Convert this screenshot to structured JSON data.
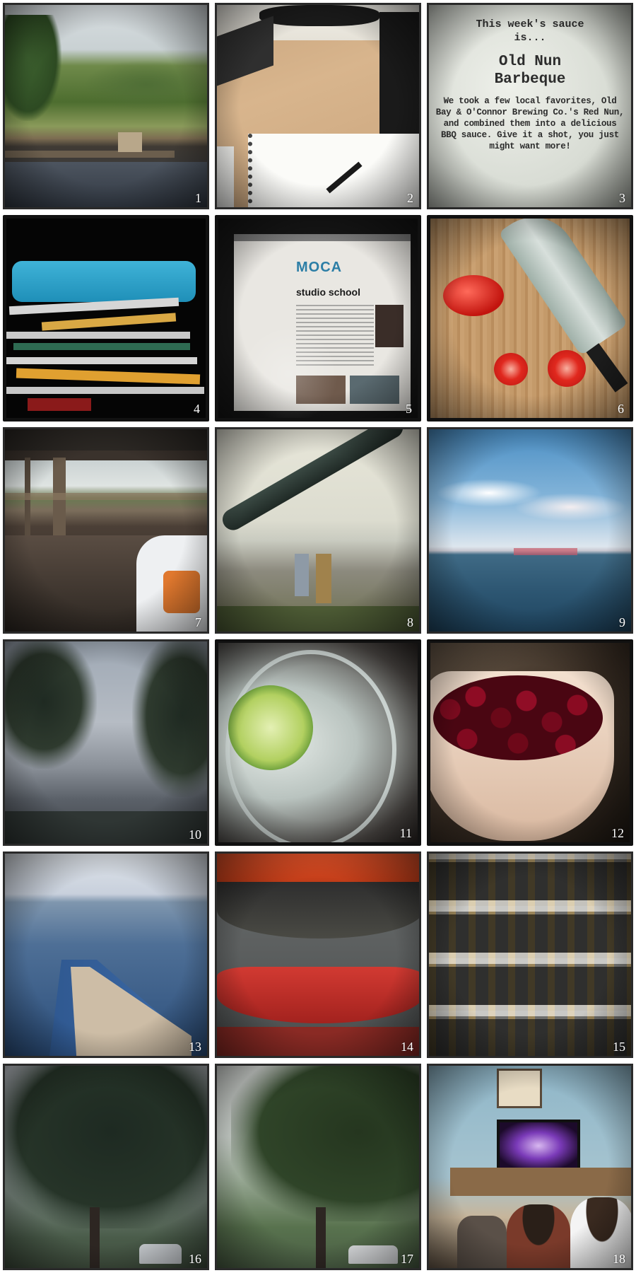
{
  "grid": {
    "tiles": [
      {
        "number": "1",
        "subject": "marsh-dock"
      },
      {
        "number": "2",
        "subject": "notebook-desk"
      },
      {
        "number": "3",
        "subject": "sauce-sign"
      },
      {
        "number": "4",
        "subject": "folding-chairs"
      },
      {
        "number": "5",
        "subject": "laptop-website"
      },
      {
        "number": "6",
        "subject": "tomatoes-knife"
      },
      {
        "number": "7",
        "subject": "boathouse"
      },
      {
        "number": "8",
        "subject": "carrying-canoe"
      },
      {
        "number": "9",
        "subject": "bay-skyline"
      },
      {
        "number": "10",
        "subject": "foggy-trees"
      },
      {
        "number": "11",
        "subject": "lime-drink"
      },
      {
        "number": "12",
        "subject": "cherries-bowl"
      },
      {
        "number": "13",
        "subject": "canoe-water"
      },
      {
        "number": "14",
        "subject": "canoe-rack"
      },
      {
        "number": "15",
        "subject": "hardware-shelf"
      },
      {
        "number": "16",
        "subject": "rainy-tree"
      },
      {
        "number": "17",
        "subject": "street-tree"
      },
      {
        "number": "18",
        "subject": "living-room-tv"
      }
    ]
  },
  "sign": {
    "line1": "This week's sauce",
    "line2": "is...",
    "line3": "Old Nun",
    "line4": "Barbeque",
    "body": "We took a few local favorites, Old Bay & O'Connor Brewing Co.'s Red Nun, and combined them into a delicious BBQ sauce. Give it a shot, you just might want more!"
  },
  "website": {
    "logo": "MOCA",
    "heading": "studio school"
  },
  "colors": {
    "frame": "#111111",
    "background": "#ffffff",
    "number": "#ffffff"
  }
}
